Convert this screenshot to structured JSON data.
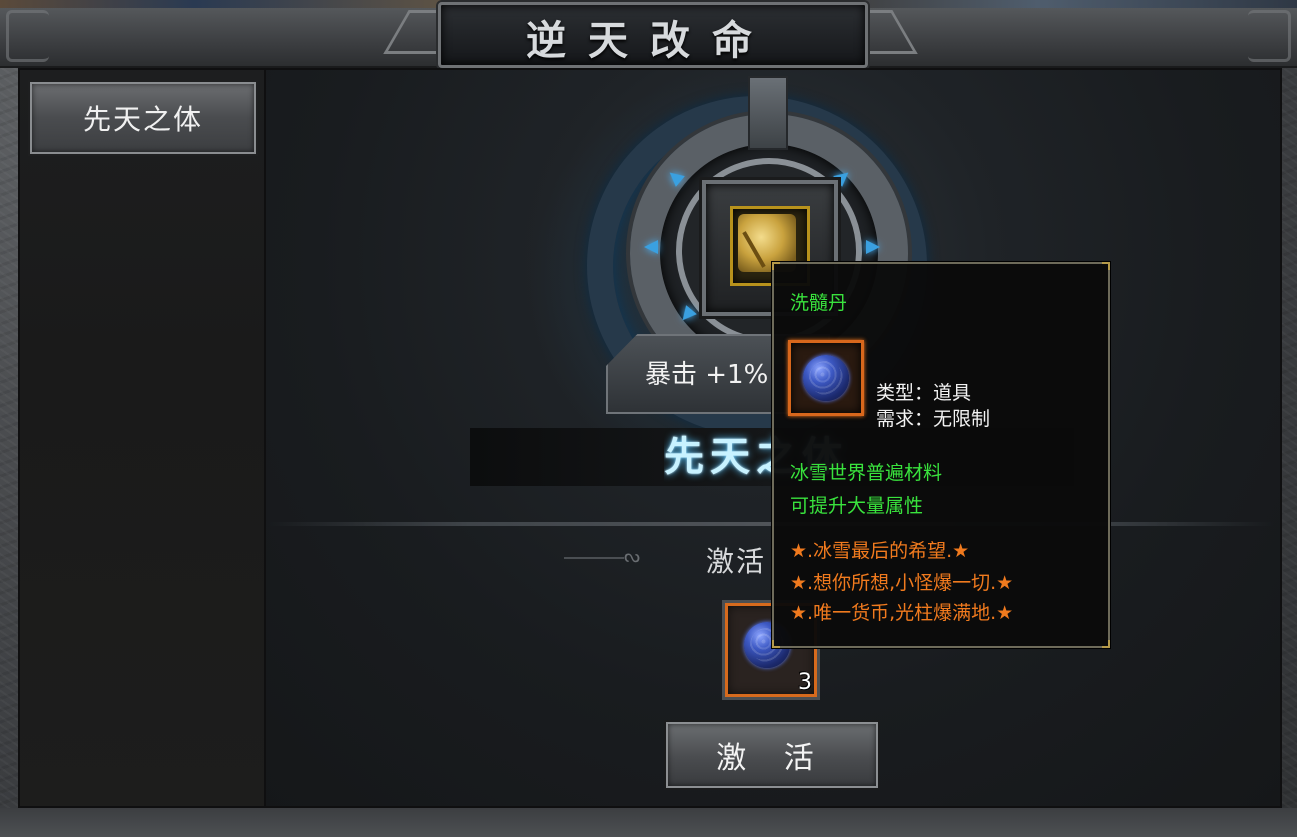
{
  "window": {
    "title": "逆天改命"
  },
  "sidebar": {
    "items": [
      {
        "label": "先天之体"
      }
    ]
  },
  "main": {
    "stat": "暴击 +1%",
    "body_name": "先天之体",
    "activate_label": "激活",
    "cost_item": {
      "icon": "blue-orb-icon",
      "count": "3"
    },
    "activate_button": "激 活"
  },
  "tooltip": {
    "name": "洗髓丹",
    "type": "类型：道具",
    "requirement": "需求：无限制",
    "desc": [
      "冰雪世界普遍材料",
      "可提升大量属性"
    ],
    "lines": [
      "★.冰雪最后的希望.★",
      "★.想你所想,小怪爆一切.★",
      "★.唯一货币,光柱爆满地.★"
    ]
  },
  "colors": {
    "tooltip_green": "#39e23d",
    "tooltip_orange": "#f07a1e",
    "glow_blue": "#56c6ff"
  }
}
